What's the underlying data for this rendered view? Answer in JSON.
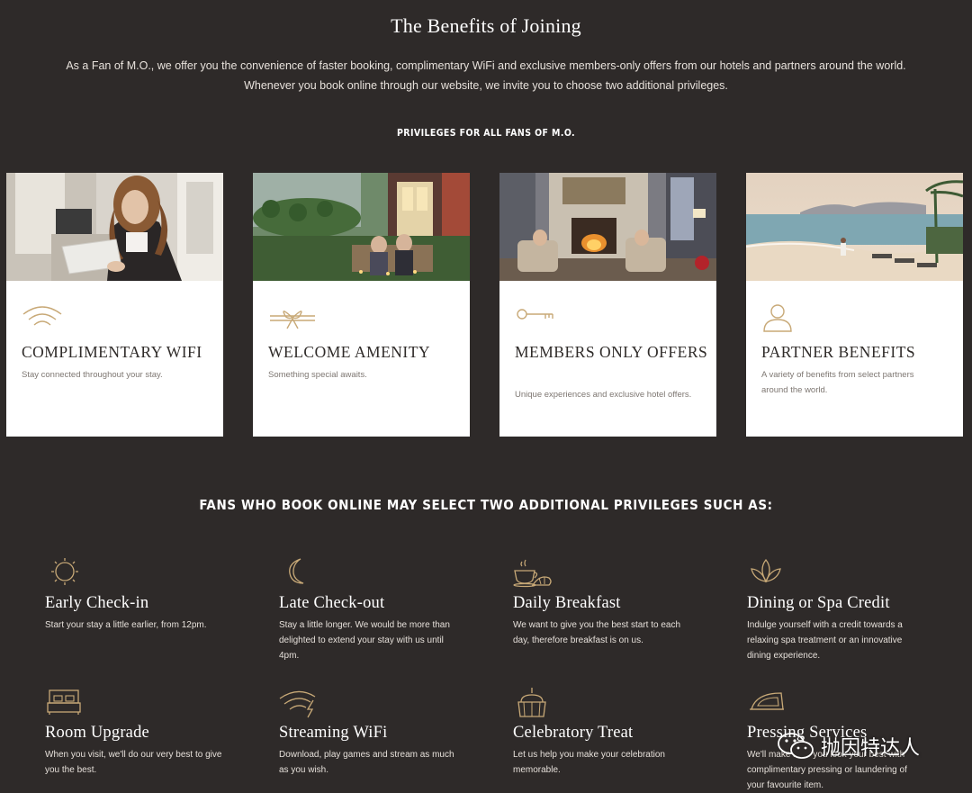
{
  "header": {
    "title": "The Benefits of Joining",
    "intro": "As a Fan of M.O., we offer you the convenience of faster booking, complimentary WiFi and exclusive members-only offers from our hotels and partners around the world. Whenever you book online through our website, we invite you to choose two additional privileges."
  },
  "privileges_all": {
    "heading": "PRIVILEGES FOR ALL FANS OF M.O.",
    "cards": [
      {
        "title": "COMPLIMENTARY WIFI",
        "desc": "Stay connected throughout your stay.",
        "icon": "wifi-icon"
      },
      {
        "title": "WELCOME AMENITY",
        "desc": "Something special awaits.",
        "icon": "gift-ribbon-icon"
      },
      {
        "title": "MEMBERS ONLY OFFERS",
        "desc": "Unique experiences and exclusive hotel offers.",
        "icon": "key-icon"
      },
      {
        "title": "PARTNER BENEFITS",
        "desc": "A variety of benefits from select partners around the world.",
        "icon": "person-icon"
      }
    ]
  },
  "additional": {
    "heading": "FANS WHO BOOK ONLINE MAY SELECT TWO ADDITIONAL PRIVILEGES SUCH AS:",
    "items": [
      {
        "title": "Early Check-in",
        "desc": "Start your stay a little earlier, from 12pm.",
        "icon": "sun-icon"
      },
      {
        "title": "Late Check-out",
        "desc": "Stay a little longer. We would be more than delighted to extend your stay with us until 4pm.",
        "icon": "moon-icon"
      },
      {
        "title": "Daily Breakfast",
        "desc": "We want to give you the best start to each day, therefore breakfast is on us.",
        "icon": "coffee-croissant-icon"
      },
      {
        "title": "Dining or Spa Credit",
        "desc": "Indulge yourself with a credit towards a relaxing spa treatment or an innovative dining experience.",
        "icon": "lotus-icon"
      },
      {
        "title": "Room Upgrade",
        "desc": "When you visit, we'll do our very best to give you the best.",
        "icon": "bed-icon"
      },
      {
        "title": "Streaming WiFi",
        "desc": "Download, play games and stream as much as you wish.",
        "icon": "streaming-wifi-icon"
      },
      {
        "title": "Celebratory Treat",
        "desc": "Let us help you make your celebration memorable.",
        "icon": "cake-icon"
      },
      {
        "title": "Pressing Services",
        "desc": "We'll make sure you look your best with complimentary pressing or laundering of your favourite item.",
        "icon": "iron-icon"
      }
    ]
  },
  "watermark": {
    "text": "抛因特达人",
    "icon": "wechat-icon"
  },
  "colors": {
    "background": "#2e2a29",
    "gold": "#c8a977",
    "card": "#ffffff"
  }
}
